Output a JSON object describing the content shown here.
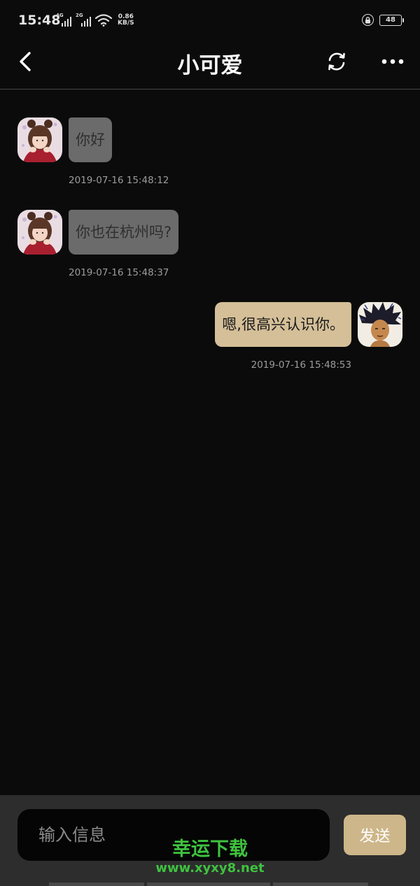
{
  "status_bar": {
    "time": "15:48",
    "network_1": "4G",
    "network_2": "2G",
    "speed_value": "0.86",
    "speed_unit": "KB/S",
    "battery": "48"
  },
  "header": {
    "title": "小可爱",
    "back_icon": "chevron-left-icon",
    "refresh_icon": "refresh-icon",
    "more_icon": "more-horizontal-icon"
  },
  "messages": [
    {
      "direction": "incoming",
      "text": "你好",
      "timestamp": "2019-07-16 15:48:12"
    },
    {
      "direction": "incoming",
      "text": "你也在杭州吗?",
      "timestamp": "2019-07-16 15:48:37"
    },
    {
      "direction": "outgoing",
      "text": "嗯,很高兴认识你。",
      "timestamp": "2019-07-16 15:48:53"
    }
  ],
  "composer": {
    "placeholder": "输入信息",
    "send_label": "发送"
  },
  "watermark": {
    "title": "幸运下载",
    "url": "www.xyxy8.net"
  },
  "colors": {
    "background": "#0b0b0b",
    "incoming_bubble": "#6b6b6b",
    "outgoing_bubble": "#d4bf98",
    "send_button": "#cdb689",
    "watermark": "#3fc23f"
  }
}
